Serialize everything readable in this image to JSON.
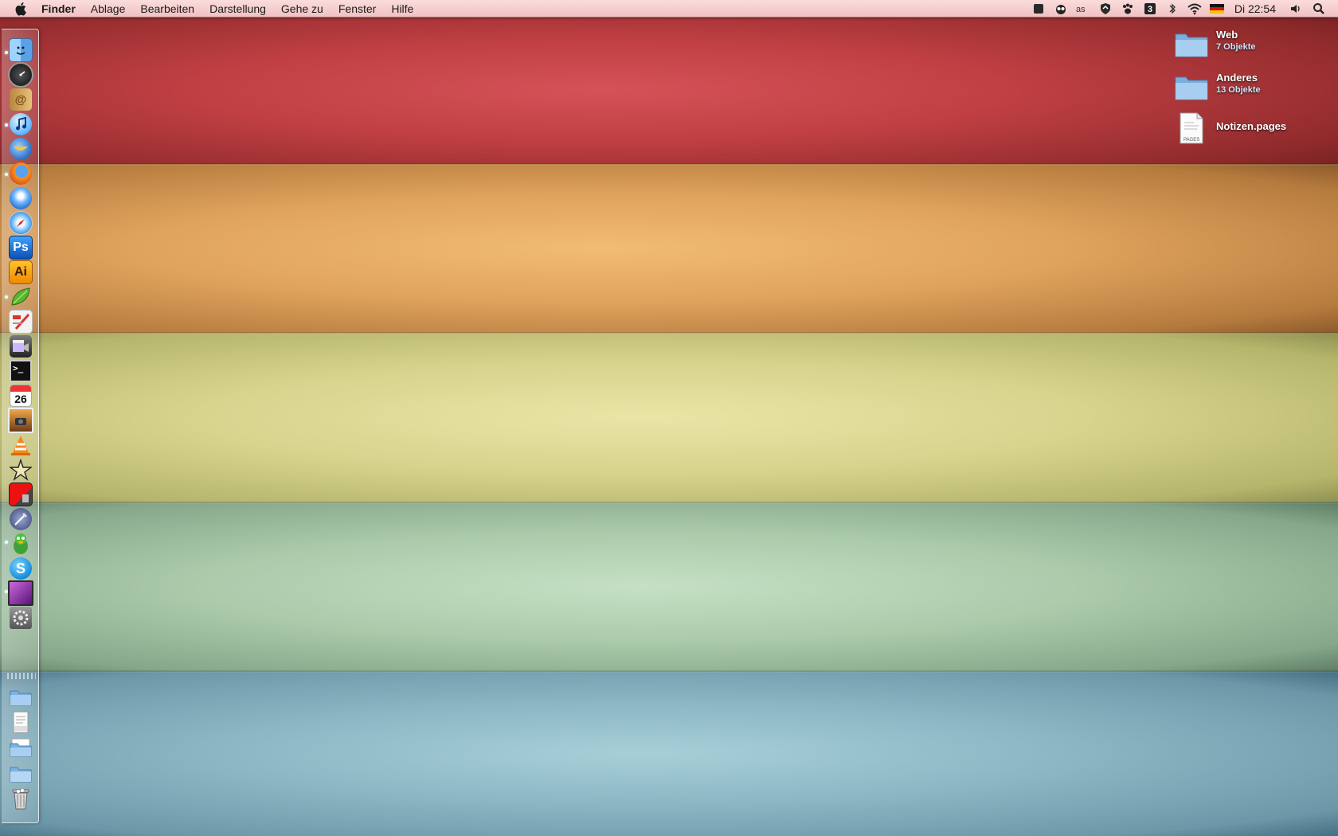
{
  "menubar": {
    "apple_icon": "apple-logo-icon",
    "app_name": "Finder",
    "menus": [
      "Ablage",
      "Bearbeiten",
      "Darstellung",
      "Gehe zu",
      "Fenster",
      "Hilfe"
    ],
    "status_icons": [
      "flag-icon",
      "owl-icon",
      "lastfm-icon",
      "shield-icon",
      "paw-icon",
      "spaces-icon",
      "bluetooth-icon",
      "wifi-icon",
      "german-flag-icon"
    ],
    "spaces_number": "3",
    "clock": "Di 22:54",
    "volume_icon": "volume-icon",
    "search_icon": "spotlight-icon"
  },
  "dock": {
    "apps": [
      {
        "name": "finder-icon",
        "running": true
      },
      {
        "name": "dashboard-icon",
        "running": false
      },
      {
        "name": "address-book-icon",
        "running": false
      },
      {
        "name": "itunes-icon",
        "running": true
      },
      {
        "name": "thunderbird-icon",
        "running": false
      },
      {
        "name": "firefox-icon",
        "running": true
      },
      {
        "name": "camino-icon",
        "running": false
      },
      {
        "name": "safari-icon",
        "running": false
      },
      {
        "name": "photoshop-icon",
        "running": false,
        "label": "Ps"
      },
      {
        "name": "illustrator-icon",
        "running": false,
        "label": "Ai"
      },
      {
        "name": "coda-icon",
        "running": true
      },
      {
        "name": "textmate-icon",
        "running": false
      },
      {
        "name": "imovie-icon",
        "running": false
      },
      {
        "name": "terminal-icon",
        "running": false
      },
      {
        "name": "ical-icon",
        "running": false,
        "label": "26"
      },
      {
        "name": "iphoto-icon",
        "running": false
      },
      {
        "name": "vlc-icon",
        "running": false
      },
      {
        "name": "imovie-star-icon",
        "running": false
      },
      {
        "name": "photo-booth-icon",
        "running": false
      },
      {
        "name": "pen-tool-icon",
        "running": false
      },
      {
        "name": "adium-icon",
        "running": true
      },
      {
        "name": "skype-icon",
        "running": false,
        "label": "S"
      },
      {
        "name": "purple-app-icon",
        "running": true
      },
      {
        "name": "system-preferences-icon",
        "running": false
      }
    ],
    "stacks": [
      {
        "name": "applications-folder-icon"
      },
      {
        "name": "documents-stack-icon"
      },
      {
        "name": "downloads-folder-icon"
      },
      {
        "name": "folder-stack-icon"
      },
      {
        "name": "trash-icon"
      }
    ]
  },
  "desktop": {
    "items": [
      {
        "name": "Web",
        "sub": "7 Objekte",
        "icon": "folder-icon"
      },
      {
        "name": "Anderes",
        "sub": "13 Objekte",
        "icon": "folder-icon"
      },
      {
        "name": "Notizen.pages",
        "sub": "",
        "icon": "pages-document-icon",
        "icon_label": "PAGES"
      }
    ]
  },
  "colors": {
    "stripe_red": "#c3434a",
    "stripe_orange": "#e3a45f",
    "stripe_yellow": "#d8d592",
    "stripe_green": "#a9caa9",
    "stripe_blue": "#86b3c1",
    "menubar": "#f5cdcd"
  }
}
